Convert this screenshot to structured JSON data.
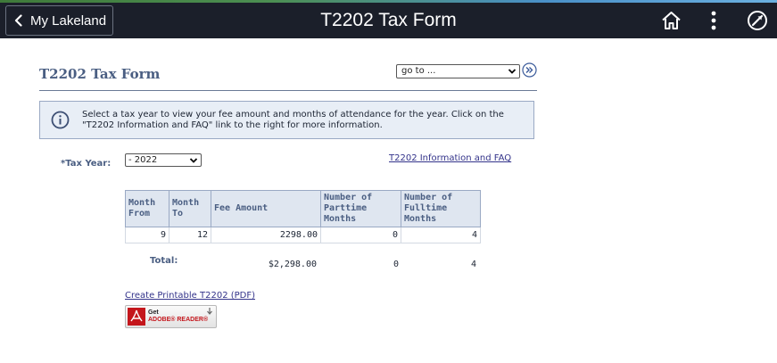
{
  "header": {
    "back_label": "My Lakeland",
    "title": "T2202 Tax Form",
    "icons": [
      "home-icon",
      "more-vertical-icon",
      "navbar-compass-icon"
    ]
  },
  "page": {
    "title": "T2202 Tax Form",
    "goto_value": "go to ...",
    "info_text": "Select a tax year to view your fee amount and months of attendance for the year. Click on the \"T2202 Information and FAQ\" link to the right for more information.",
    "tax_year_label": "*Tax Year:",
    "tax_year_value": "- 2022",
    "faq_link": "T2202 Information and FAQ"
  },
  "table": {
    "headers": [
      "Month From",
      "Month To",
      "Fee Amount",
      "Number of Parttime Months",
      "Number of Fulltime Months"
    ],
    "rows": [
      [
        "9",
        "12",
        "2298.00",
        "0",
        "4"
      ]
    ],
    "total_label": "Total:",
    "totals": [
      "$2,298.00",
      "0",
      "4"
    ]
  },
  "footer": {
    "pdf_link": "Create Printable T2202 (PDF)",
    "adobe_get": "Get",
    "adobe_product": "ADOBE® READER®"
  },
  "colors": {
    "topbar": "#1b1f2a",
    "heading": "#4a5e82",
    "link": "#33338a",
    "info_bg": "#e8eef6",
    "adobe_red": "#c4161c"
  }
}
